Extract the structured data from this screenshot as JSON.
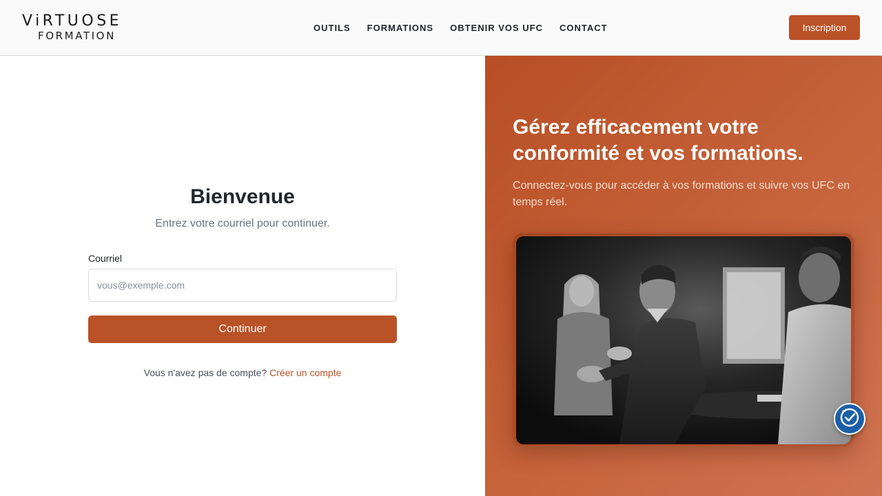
{
  "brand": {
    "line1": "ViRTUOSE",
    "line2": "FORMATION"
  },
  "nav": {
    "items": [
      {
        "label": "OUTILS"
      },
      {
        "label": "FORMATIONS"
      },
      {
        "label": "OBTENIR VOS UFC"
      },
      {
        "label": "CONTACT"
      }
    ]
  },
  "header": {
    "signup_label": "Inscription"
  },
  "login": {
    "title": "Bienvenue",
    "subtitle": "Entrez votre courriel pour continuer.",
    "email_label": "Courriel",
    "email_placeholder": "vous@exemple.com",
    "email_value": "",
    "continue_label": "Continuer",
    "no_account_text": "Vous n'avez pas de compte?",
    "create_account_link": "Créer un compte"
  },
  "hero": {
    "title": "Gérez efficacement votre conformité et vos formations.",
    "subtitle": "Connectez-vous pour accéder à vos formations et suivre vos UFC en temps réel."
  },
  "colors": {
    "accent": "#ba5227",
    "hero_gradient_start": "#b84e24",
    "hero_gradient_end": "#cf7352",
    "accessibility_button": "#1a5fa8"
  },
  "icons": {
    "accessibility": "accessibility-check-icon"
  }
}
